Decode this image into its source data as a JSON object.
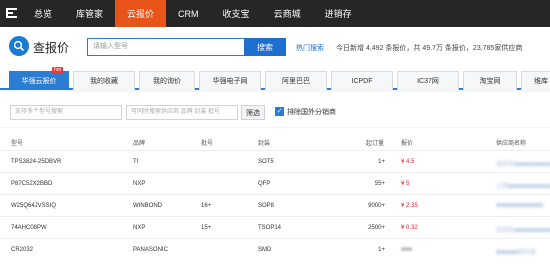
{
  "nav": {
    "logo_icon": "cloud-logo-icon",
    "items": [
      {
        "label": "总览"
      },
      {
        "label": "库管家"
      },
      {
        "label": "云报价",
        "active": true
      },
      {
        "label": "CRM"
      },
      {
        "label": "收支宝"
      },
      {
        "label": "云商城"
      },
      {
        "label": "进销存"
      }
    ]
  },
  "header": {
    "icon": "search-icon",
    "title": "查报价",
    "search_placeholder": "请输入型号",
    "search_button": "搜索",
    "hot_link": "热门搜索",
    "stats": "今日新增 4,492 条报价，共 49.7万 条报价，23,785家供应商"
  },
  "tabs": {
    "badge": "hot",
    "items": [
      {
        "label": "华强云报价",
        "active": true
      },
      {
        "label": "我的收藏"
      },
      {
        "label": "我的询价"
      },
      {
        "label": "华强电子网"
      },
      {
        "label": "阿里巴巴"
      },
      {
        "label": "ICPDF"
      },
      {
        "label": "IC37网"
      },
      {
        "label": "淘宝网"
      },
      {
        "label": "维库"
      }
    ]
  },
  "filters": {
    "model_placeholder": "支持多个型号搜索",
    "extra_placeholder": "可同时搜索供应商 品牌 封装 批号",
    "filter_button": "筛选",
    "exclude_label": "排除国外分销商",
    "exclude_checked": true
  },
  "table": {
    "columns": {
      "model": "型号",
      "brand": "品牌",
      "batch": "批号",
      "package": "封装",
      "moq": "起订量",
      "price": "报价",
      "supplier": "供应商名称"
    },
    "rows": [
      {
        "model": "TPS3824-25DBVR",
        "brand": "TI",
        "batch": "",
        "package": "SOT5",
        "moq": "1+",
        "price": "¥ 4.5",
        "supplier": "深圳市■■■■■■■■■■■"
      },
      {
        "model": "P87C52X2BBD",
        "brand": "NXP",
        "batch": "",
        "package": "QFP",
        "moq": "55+",
        "price": "¥ 5",
        "supplier": "上海■■■■■■■■■■■■"
      },
      {
        "model": "W25Q64JVSSIQ",
        "brand": "WINBOND",
        "batch": "16+",
        "package": "SOP8",
        "moq": "9000+",
        "price": "¥ 2.35",
        "supplier": "■■■■■■■■■■■■■"
      },
      {
        "model": "74AHC08PW",
        "brand": "NXP",
        "batch": "15+",
        "package": "TSOP14",
        "moq": "2500+",
        "price": "¥ 0.32",
        "supplier": "深圳市■■■■■■■■■■■"
      },
      {
        "model": "CR2032",
        "brand": "PANASONIC",
        "batch": "",
        "package": "SMD",
        "moq": "1+",
        "price": "■■■",
        "supplier": "■■■■■■供应商"
      }
    ]
  },
  "colors": {
    "nav_bg": "#262626",
    "accent_orange": "#e8541a",
    "primary_blue": "#2b7cd3",
    "price_red": "#e0242d"
  }
}
